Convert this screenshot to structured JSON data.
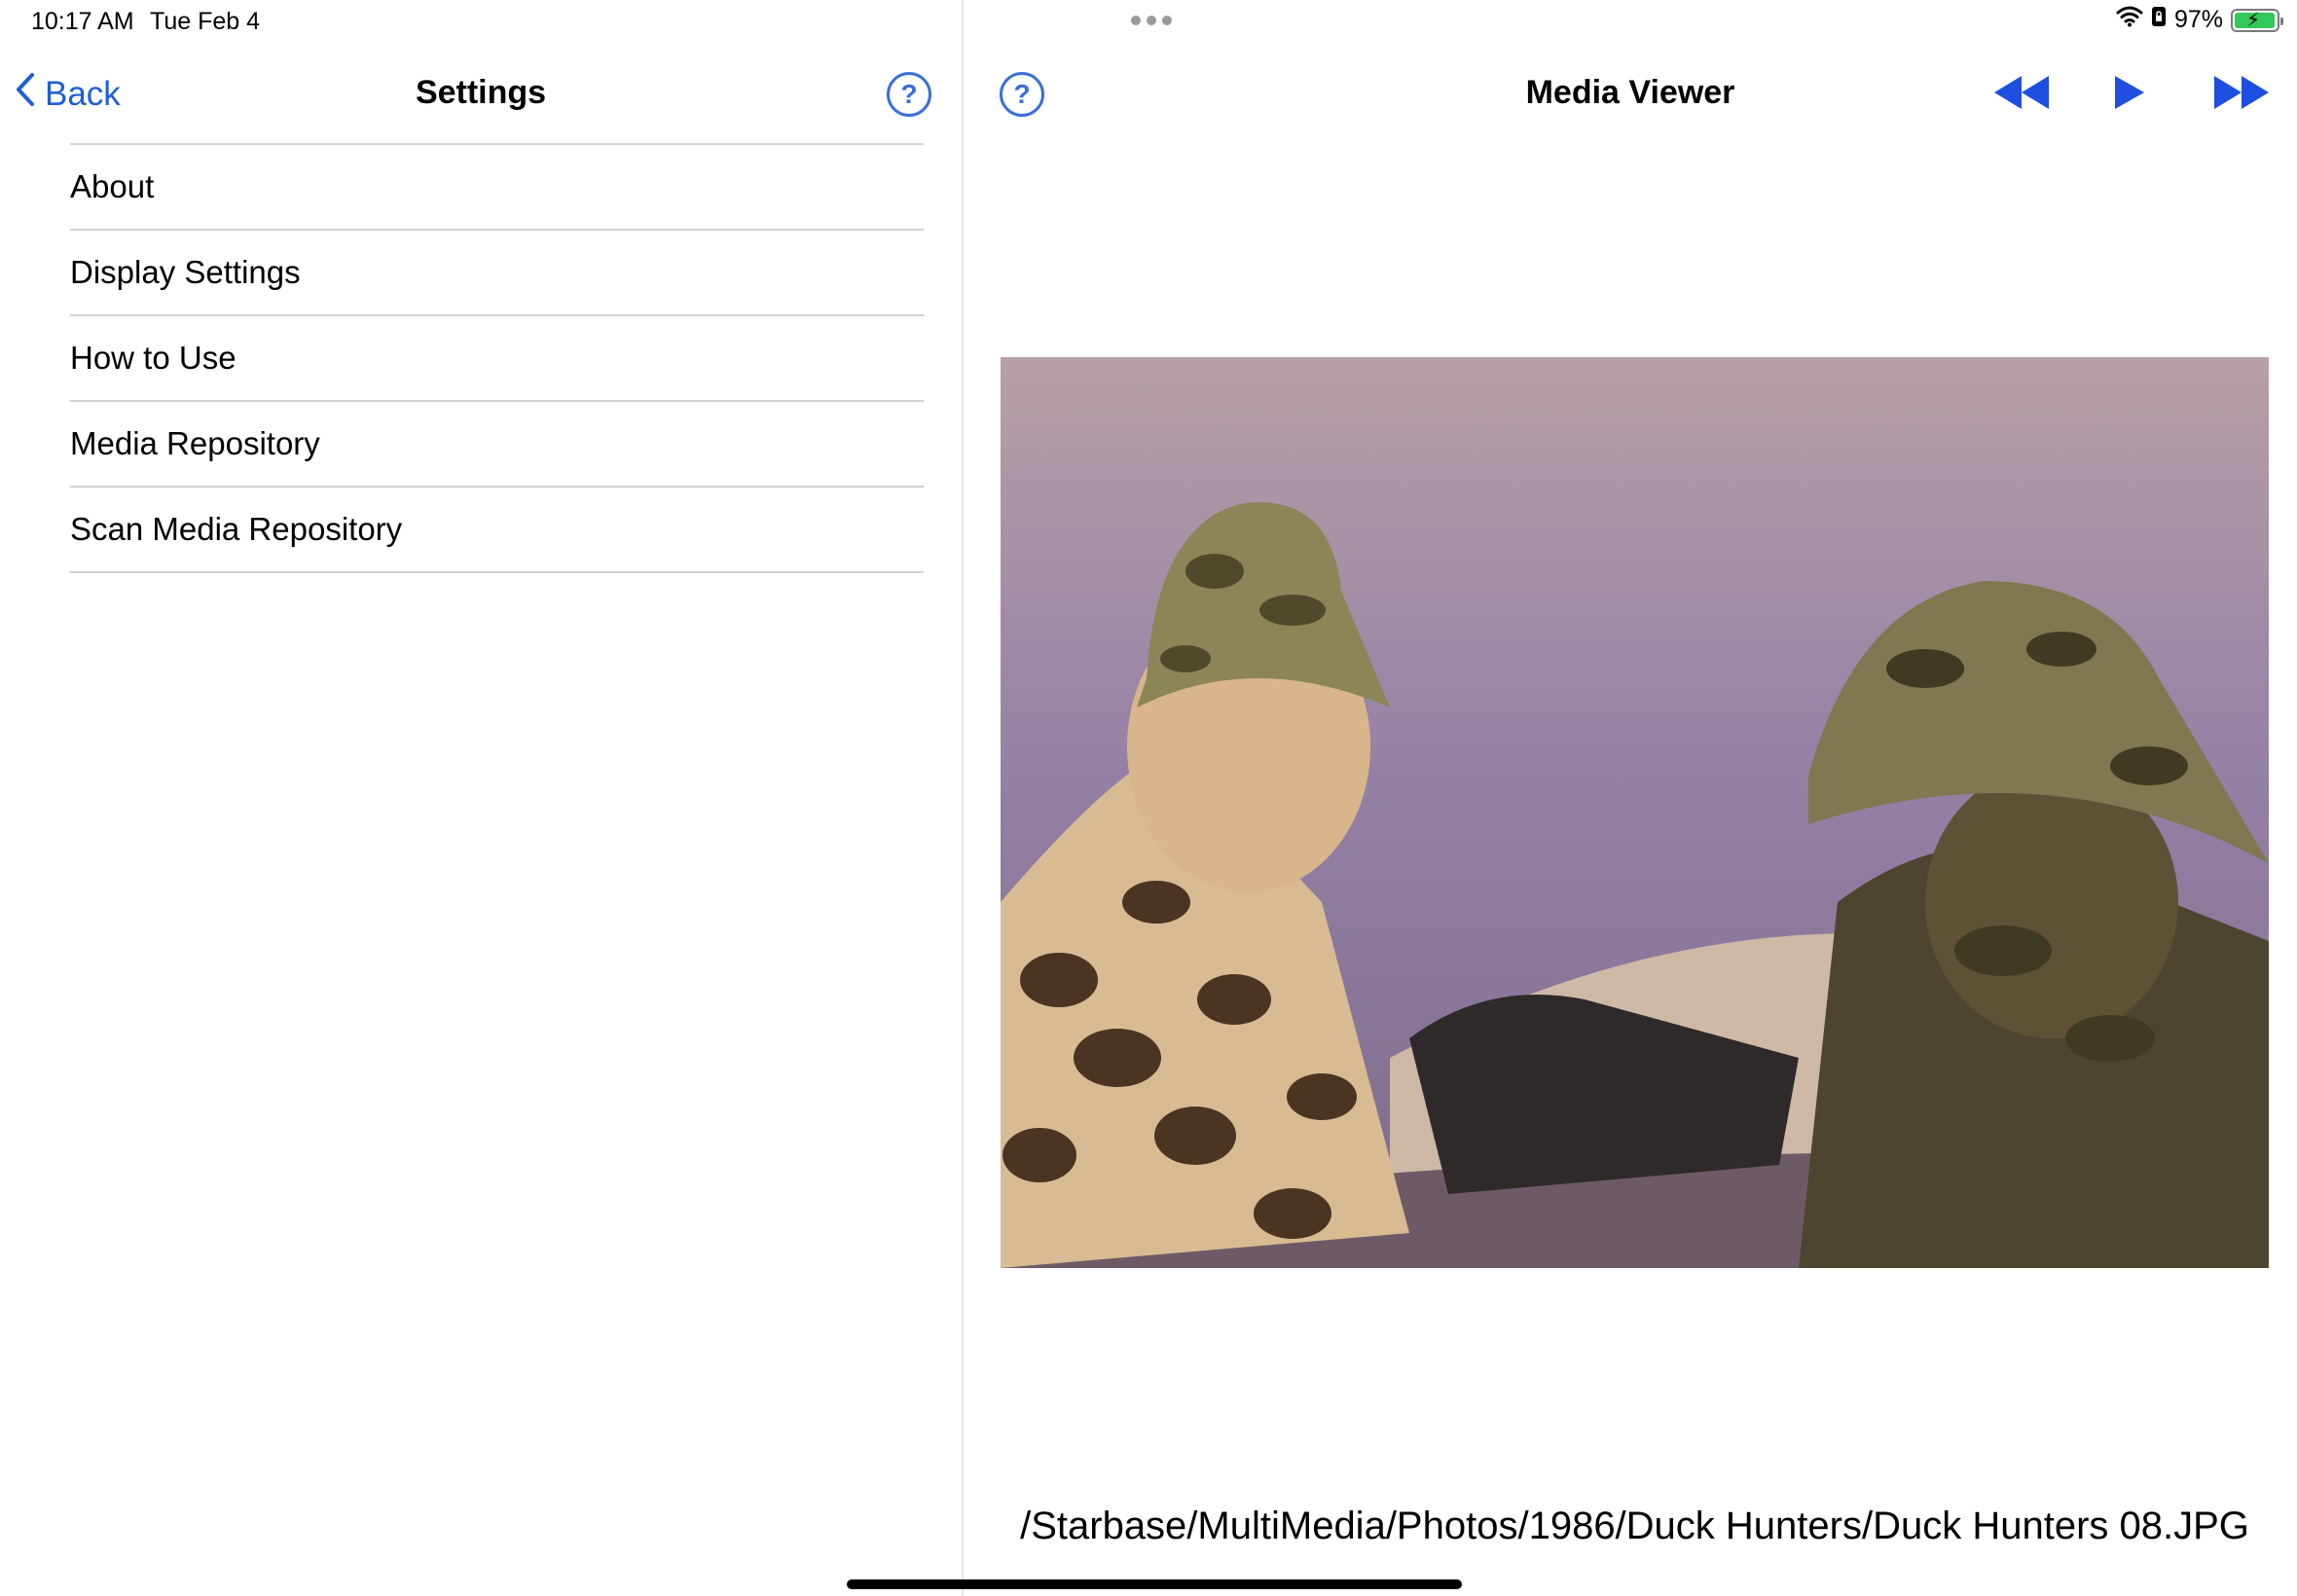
{
  "status_bar": {
    "time": "10:17 AM",
    "date": "Tue Feb 4",
    "battery_percent": "97%",
    "battery_level": 0.97,
    "battery_color": "#34c759"
  },
  "left_pane": {
    "back_label": "Back",
    "title": "Settings",
    "help_glyph": "?",
    "menu_items": [
      {
        "label": "About"
      },
      {
        "label": "Display Settings"
      },
      {
        "label": "How to Use"
      },
      {
        "label": "Media Repository"
      },
      {
        "label": "Scan Media Repository"
      }
    ]
  },
  "right_pane": {
    "help_glyph": "?",
    "title": "Media Viewer",
    "controls": [
      "rewind-icon",
      "play-icon",
      "fast-forward-icon"
    ],
    "accent_color": "#1f4fe0",
    "file_path": "/Starbase/MultiMedia/Photos/1986/Duck Hunters/Duck Hunters 08.JPG"
  }
}
